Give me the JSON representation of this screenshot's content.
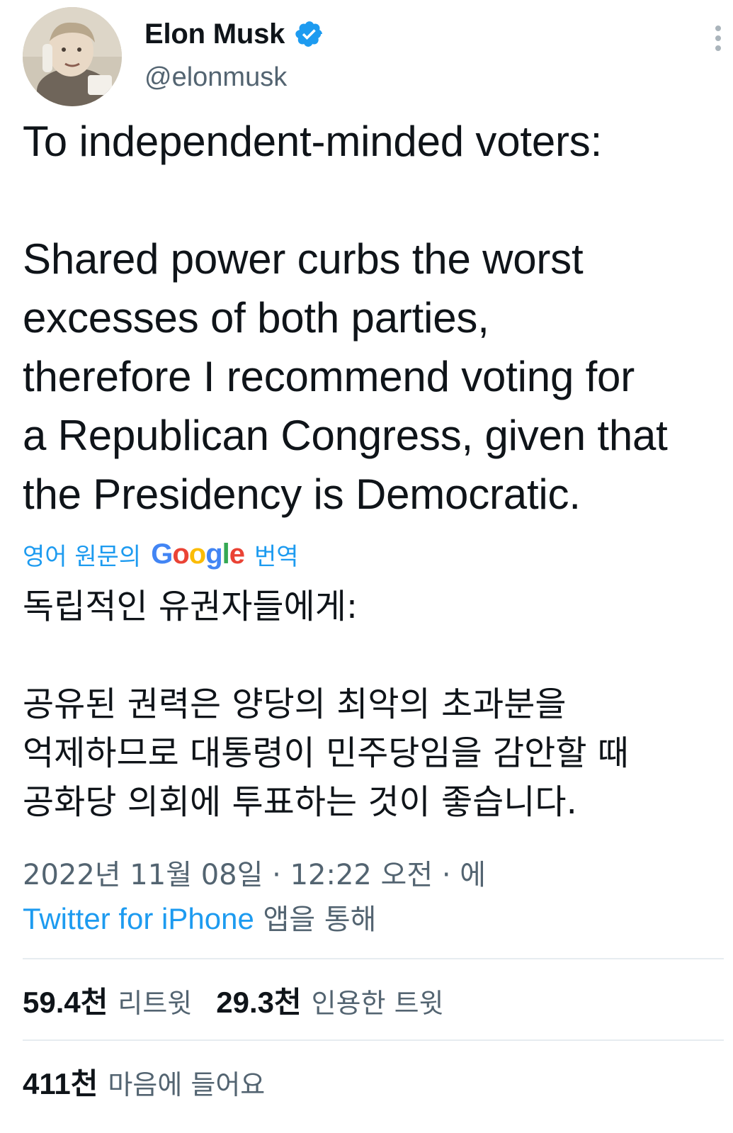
{
  "author": {
    "display_name": "Elon Musk",
    "handle": "@elonmusk",
    "verified": true,
    "avatar": "child-photo-avatar"
  },
  "tweet": {
    "text": "To independent-minded voters:\n\nShared power curbs the worst\nexcesses of both parties,\ntherefore I recommend voting for\na Republican Congress, given that\nthe Presidency is Democratic."
  },
  "translation": {
    "prefix": "영어 원문의",
    "provider": "Google",
    "suffix": "번역",
    "text": "독립적인 유권자들에게:\n\n공유된 권력은 양당의 최악의 초과분을\n억제하므로 대통령이 민주당임을 감안할 때\n공화당 의회에 투표하는 것이 좋습니다."
  },
  "meta": {
    "timestamp": "2022년 11월 08일 · 12:22 오전 · 에",
    "source": "Twitter for iPhone",
    "source_suffix": "앱을 통해"
  },
  "stats": {
    "retweets": {
      "count": "59.4천",
      "label": "리트윗"
    },
    "quotes": {
      "count": "29.3천",
      "label": "인용한 트윗"
    },
    "likes": {
      "count": "411천",
      "label": "마음에 들어요"
    }
  },
  "colors": {
    "link": "#1d9bf0",
    "text": "#0f1419",
    "secondary": "#536471",
    "verified": "#1d9bf0"
  },
  "icons": {
    "verified": "verified-badge-icon",
    "more": "more-options-icon"
  }
}
